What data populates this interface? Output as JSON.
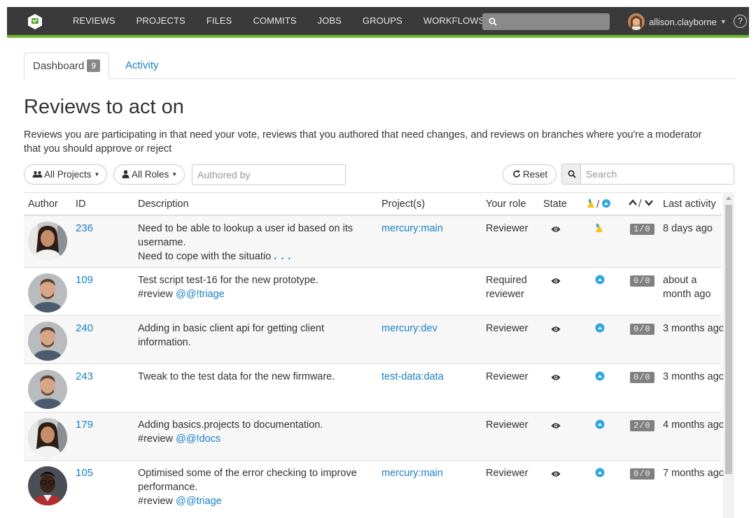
{
  "nav": {
    "logo_icon": "swarm-logo-icon",
    "items": [
      "REVIEWS",
      "PROJECTS",
      "FILES",
      "COMMITS",
      "JOBS",
      "GROUPS",
      "WORKFLOWS"
    ],
    "search_icon": "search-icon",
    "user": "allison.clayborne",
    "help": "?"
  },
  "tabs": {
    "dashboard_label": "Dashboard",
    "dashboard_count": "9",
    "activity_label": "Activity"
  },
  "page": {
    "title": "Reviews to act on",
    "intro": "Reviews you are participating in that need your vote, reviews that you authored that need changes, and reviews on branches where you're a moderator that you should approve or reject"
  },
  "filters": {
    "projects_label": "All Projects",
    "roles_label": "All Roles",
    "authored_placeholder": "Authored by",
    "reset_label": "Reset",
    "search_placeholder": "Search"
  },
  "table": {
    "headers": {
      "author": "Author",
      "id": "ID",
      "description": "Description",
      "projects": "Project(s)",
      "role": "Your role",
      "state": "State",
      "votes": "↑/↓",
      "last": "Last activity"
    },
    "rows": [
      {
        "id": "236",
        "desc_1": "Need to be able to lookup a user id based on its username.",
        "desc_2": "Need to cope with the situatio",
        "more": ". . .",
        "project": "mercury:main",
        "role": "Reviewer",
        "vote_icon": "up-vote-icon",
        "count": "1/0",
        "last": "8 days ago",
        "avatar": "woman"
      },
      {
        "id": "109",
        "desc_1": "Test script test-16 for the new prototype.",
        "desc_tag": "#review",
        "desc_link": "@@!triage",
        "project": "",
        "role": "Required reviewer",
        "vote_icon": "circle-up-icon",
        "count": "0/0",
        "last": "about a month ago",
        "avatar": "man"
      },
      {
        "id": "240",
        "desc_1": "Adding in basic client api for getting client information.",
        "project": "mercury:dev",
        "role": "Reviewer",
        "vote_icon": "circle-up-icon",
        "count": "0/0",
        "last": "3 months ago",
        "avatar": "man"
      },
      {
        "id": "243",
        "desc_1": "Tweak to the test data for the new firmware.",
        "project": "test-data:data",
        "role": "Reviewer",
        "vote_icon": "circle-up-icon",
        "count": "0/0",
        "last": "3 months ago",
        "avatar": "man"
      },
      {
        "id": "179",
        "desc_1": "Adding basics.projects to documentation.",
        "desc_tag": "#review",
        "desc_link": "@@!docs",
        "project": "",
        "role": "Reviewer",
        "vote_icon": "circle-up-icon",
        "count": "2/0",
        "last": "4 months ago",
        "avatar": "woman"
      },
      {
        "id": "105",
        "desc_1": "Optimised some of the error checking to improve performance.",
        "desc_tag": "#review",
        "desc_link": "@@triage",
        "project": "mercury:main",
        "role": "Reviewer",
        "vote_icon": "circle-up-icon",
        "count": "0/0",
        "last": "7 months ago",
        "avatar": "dark"
      }
    ]
  },
  "colors": {
    "navbar": "#3a3a3a",
    "accent_green": "#6bb331",
    "link": "#1a80c4",
    "vote_blue": "#2fa8dc",
    "vote_yellow": "#f0c419"
  }
}
